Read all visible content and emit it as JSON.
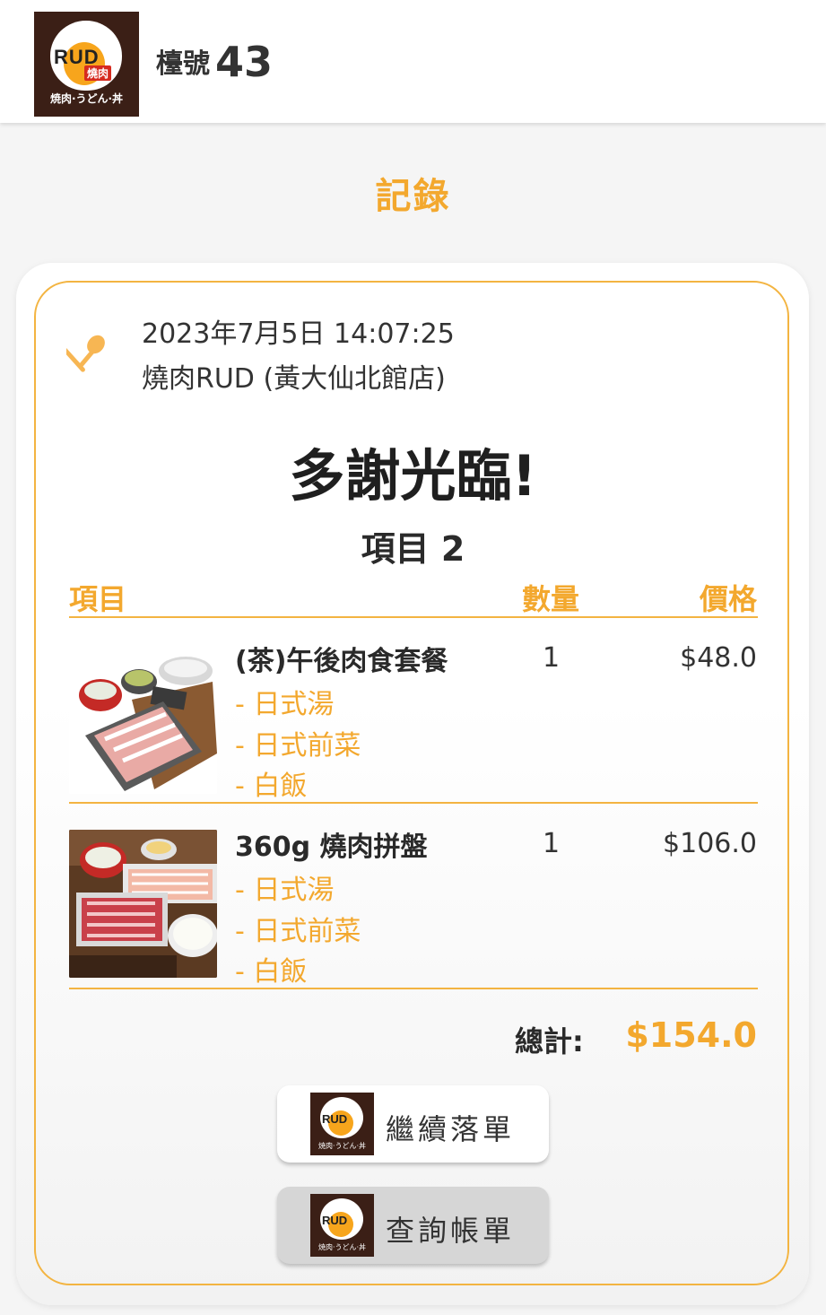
{
  "header": {
    "logo_text": "RUD",
    "logo_tag": "燒肉",
    "logo_sub": "焼肉·うどん·丼",
    "table_label": "檯號",
    "table_number": "43"
  },
  "page_title": "記錄",
  "order": {
    "datetime": "2023年7月5日 14:07:25",
    "shop": "燒肉RUD (黃大仙北館店)",
    "thanks": "多謝光臨!",
    "item_count": "項目 2"
  },
  "columns": {
    "item": "項目",
    "qty": "數量",
    "price": "價格"
  },
  "items": [
    {
      "name": "(茶)午後肉食套餐",
      "options": [
        "- 日式湯",
        "- 日式前菜",
        "- 白飯"
      ],
      "qty": "1",
      "price": "$48.0"
    },
    {
      "name": "360g 燒肉拼盤",
      "options": [
        "- 日式湯",
        "- 日式前菜",
        "- 白飯"
      ],
      "qty": "1",
      "price": "$106.0"
    }
  ],
  "total": {
    "label": "總計:",
    "value": "$154.0"
  },
  "buttons": {
    "continue_order": "繼續落單",
    "view_bill": "查詢帳單"
  },
  "colors": {
    "accent": "#f3a82e",
    "brand_dark": "#3b1f16"
  }
}
